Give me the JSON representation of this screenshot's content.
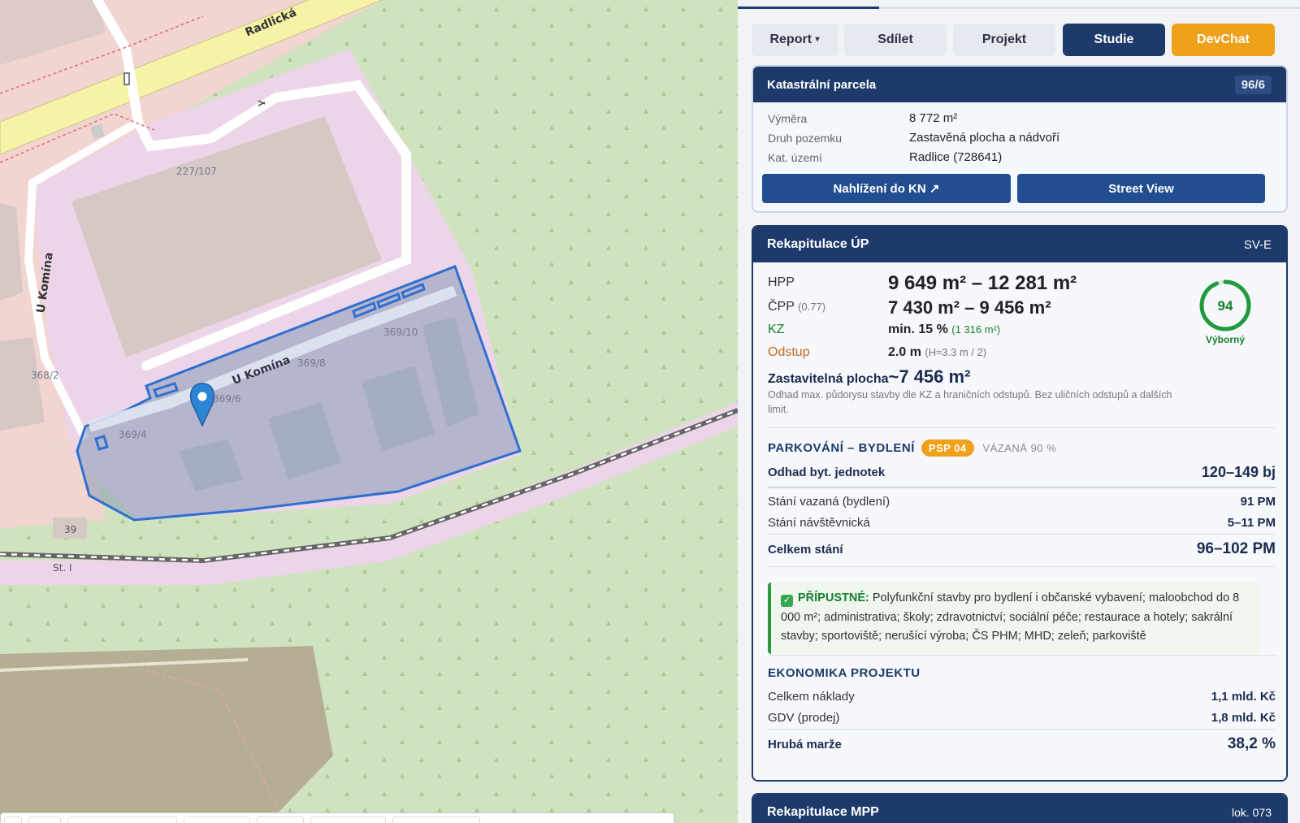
{
  "map": {
    "roads": {
      "radlicka": "Radlická",
      "u_komina_vertical": "U Komína",
      "u_komina_diag": "U Komína"
    },
    "parcels": [
      "227/107",
      "369/10",
      "369/8",
      "369/6",
      "369/4",
      "368/2"
    ],
    "house_numbers": [
      "39",
      "St. I"
    ],
    "colors": {
      "forest": "#cfe3bf",
      "residential": "#f2d4d0",
      "commercial": "#ecd5e8",
      "building": "#d6c8c4",
      "road_yellow": "#f6f3a6",
      "railway": "#666666",
      "highlight": "#2f6fd0"
    },
    "marker": "location-pin-icon"
  },
  "tabs": {
    "report": "Report",
    "report_caret": "▾",
    "share": "Sdílet",
    "project": "Projekt",
    "study": "Studie",
    "devchat": "DevChat"
  },
  "cadastre": {
    "title": "Katastrální parcela",
    "parcel_no": "96/6",
    "area_label": "Výměra",
    "area_value": "8 772 m²",
    "type_label": "Druh pozemku",
    "type_value": "Zastavěná plocha a nádvoří",
    "territory_label": "Kat. území",
    "territory_value": "Radlice (728641)",
    "btn_kn": "Nahlížení do KN ↗",
    "btn_street": "Street View"
  },
  "up": {
    "title": "Rekapitulace ÚP",
    "code": "SV-E",
    "hpp_label": "HPP",
    "hpp_value": "9 649 m² – 12 281 m²",
    "cpp_label": "ČPP",
    "cpp_coef": "(0.77)",
    "cpp_value": "7 430 m² – 9 456 m²",
    "kz_label": "KZ",
    "kz_value": "min. 15 %",
    "kz_sub": "(1 316 m²)",
    "odstup_label": "Odstup",
    "odstup_value": "2.0 m",
    "odstup_sub": "(H≈3.3 m / 2)",
    "zast_label": "Zastavitelná plocha",
    "zast_value": "~7 456 m²",
    "zast_note": "Odhad max. půdorysu stavby dle KZ a hraničních odstupů. Bez uličních odstupů a dalších limit.",
    "score": "94",
    "score_fraction": 0.94,
    "score_label": "Výborný",
    "parking_title": "PARKOVÁNÍ – BYDLENÍ",
    "parking_pill": "PSP 04",
    "parking_bound": "VÁZANÁ 90 %",
    "units_label": "Odhad byt. jednotek",
    "units_value": "120–149 bj",
    "bound_label": "Stání vazaná (bydlení)",
    "bound_value": "91 PM",
    "visitor_label": "Stání návštěvnická",
    "visitor_value": "5–11 PM",
    "total_label": "Celkem stání",
    "total_value": "96–102 PM",
    "allowed_label": "PŘÍPUSTNÉ:",
    "allowed_text": "Polyfunkční stavby pro bydlení i občanské vybavení; maloobchod do 8 000 m²; administrativa; školy; zdravotnictví; sociální péče; restaurace a hotely; sakrální stavby; sportoviště; nerušící výroba; ČS PHM; MHD; zeleň; parkoviště",
    "econ_title": "EKONOMIKA PROJEKTU",
    "cost_label": "Celkem náklady",
    "cost_value": "1,1 mld. Kč",
    "gdv_label": "GDV (prodej)",
    "gdv_value": "1,8 mld. Kč",
    "margin_label": "Hrubá marže",
    "margin_value": "38,2 %"
  },
  "mpp": {
    "title": "Rekapitulace MPP",
    "code": "lok. 073"
  }
}
